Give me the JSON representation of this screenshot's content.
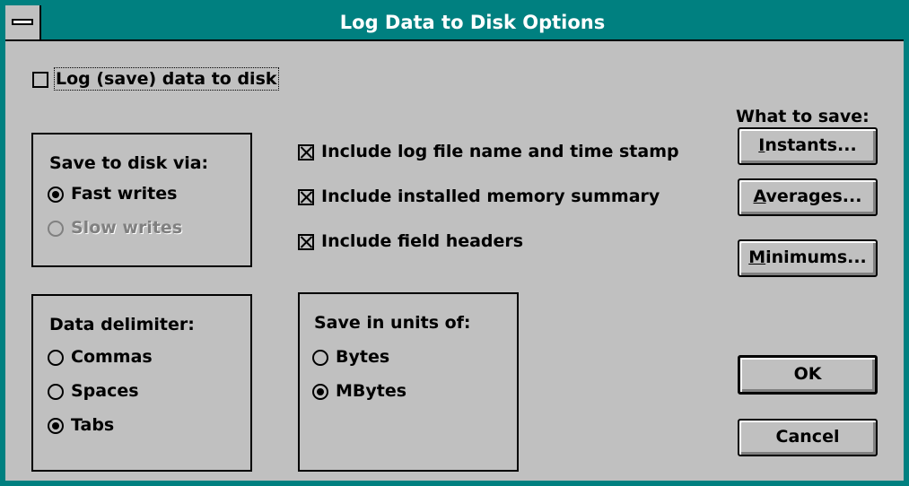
{
  "window": {
    "title": "Log Data to Disk Options"
  },
  "log_checkbox": {
    "label": "Log (save) data to disk",
    "checked": false
  },
  "save_via": {
    "label": "Save to disk via:",
    "options": [
      {
        "label": "Fast writes",
        "selected": true,
        "enabled": true
      },
      {
        "label": "Slow writes",
        "selected": false,
        "enabled": false
      }
    ]
  },
  "include_options": [
    {
      "label": "Include log file name and time stamp",
      "checked": true
    },
    {
      "label": "Include installed memory summary",
      "checked": true
    },
    {
      "label": "Include field headers",
      "checked": true
    }
  ],
  "delimiter": {
    "label": "Data delimiter:",
    "options": [
      {
        "label": "Commas",
        "selected": false
      },
      {
        "label": "Spaces",
        "selected": false
      },
      {
        "label": "Tabs",
        "selected": true
      }
    ]
  },
  "units": {
    "label": "Save in units of:",
    "options": [
      {
        "label": "Bytes",
        "selected": false
      },
      {
        "label": "MBytes",
        "selected": true
      }
    ]
  },
  "what_to_save": {
    "label": "What to save:",
    "instants": {
      "mnemonic": "I",
      "rest": "nstants..."
    },
    "averages": {
      "mnemonic": "A",
      "rest": "verages..."
    },
    "minimums": {
      "mnemonic": "M",
      "rest": "inimums..."
    }
  },
  "buttons": {
    "ok": "OK",
    "cancel": "Cancel"
  }
}
